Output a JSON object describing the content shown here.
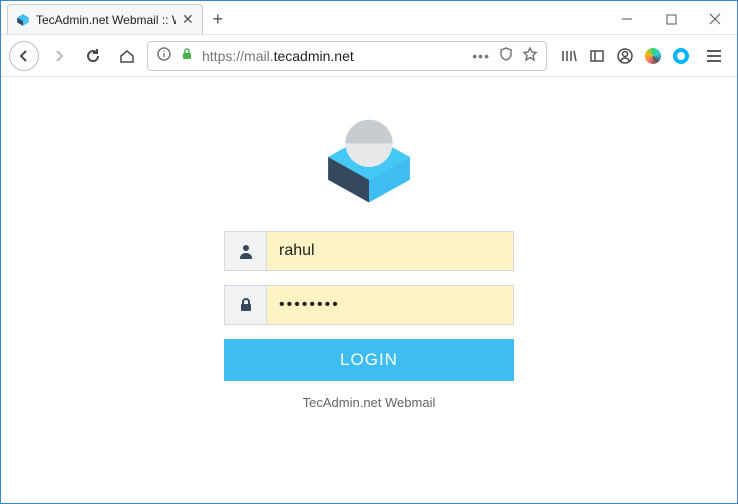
{
  "browser": {
    "tab_title": "TecAdmin.net Webmail :: Welc",
    "url_prefix": "https://",
    "url_rest": "mail.",
    "url_domain": "tecadmin.net"
  },
  "login": {
    "username_value": "rahul",
    "password_value": "••••••••",
    "button_label": "LOGIN",
    "footer": "TecAdmin.net Webmail"
  }
}
